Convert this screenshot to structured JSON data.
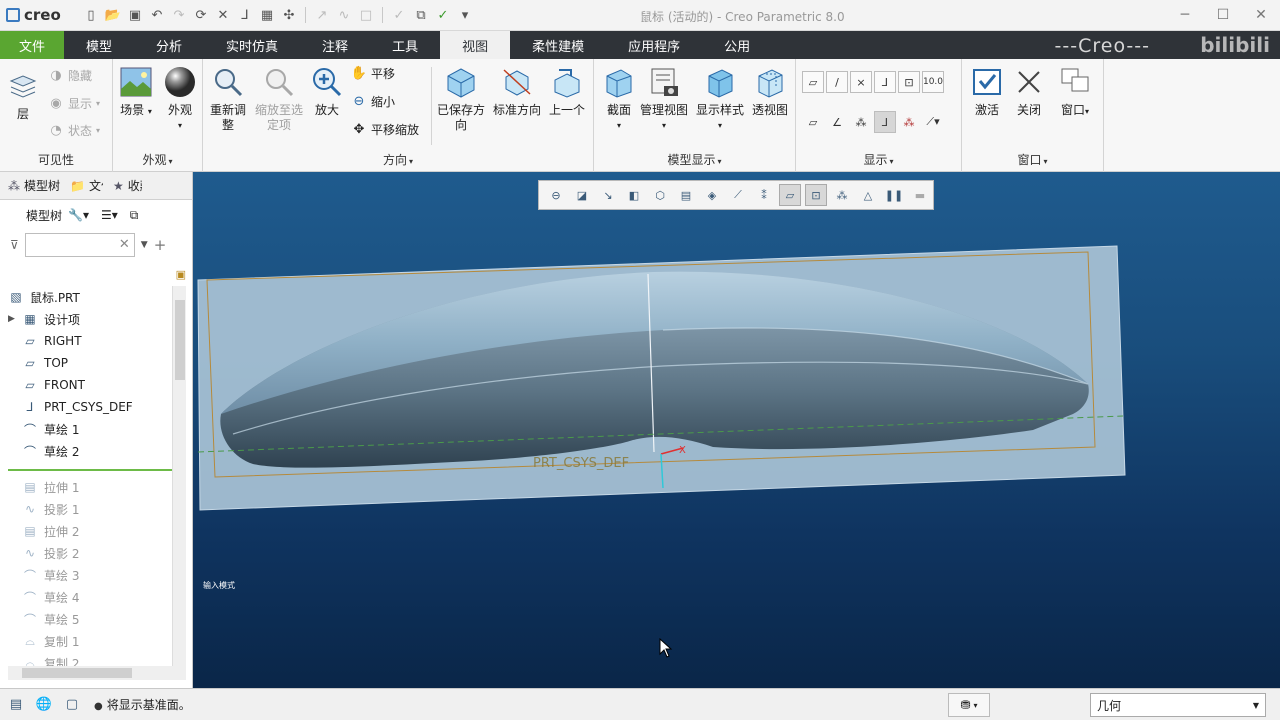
{
  "app": {
    "logo": "creo",
    "window_title": "鼠标 (活动的) - Creo Parametric 8.0"
  },
  "tabs": [
    "文件",
    "模型",
    "分析",
    "实时仿真",
    "注释",
    "工具",
    "视图",
    "柔性建模",
    "应用程序",
    "公用"
  ],
  "active_tab": "视图",
  "brand": "---Creo---",
  "watermark": "bilibili",
  "ribbon": {
    "visibility": {
      "label": "可见性",
      "layer": "层",
      "hide": "隐藏",
      "show": "显示",
      "status": "状态"
    },
    "appearance": {
      "label": "外观",
      "scene": "场景",
      "appearance": "外观"
    },
    "orientation": {
      "label": "方向",
      "refit": "重新调整",
      "zoom_to_selected": "缩放至选定项",
      "zoom_in": "放大",
      "pan": "平移",
      "zoom_out": "缩小",
      "pan_zoom": "平移缩放",
      "saved_orientations": "已保存方向",
      "standard_orientation": "标准方向",
      "previous": "上一个"
    },
    "model_display": {
      "label": "模型显示",
      "section": "截面",
      "manage_views": "管理视图",
      "display_style": "显示样式",
      "perspective": "透视图"
    },
    "show": {
      "label": "显示",
      "decimal": "10.0"
    },
    "window": {
      "label": "窗口",
      "activate": "激活",
      "close": "关闭",
      "windows": "窗口"
    }
  },
  "left_panel": {
    "tabs": [
      "模型树",
      "文件",
      "收藏"
    ],
    "tree_label": "模型树",
    "filter_placeholder": "",
    "items": [
      {
        "label": "鼠标.PRT",
        "icon": "part-icon",
        "expand": "",
        "gray": false
      },
      {
        "label": "设计项",
        "icon": "design-items-icon",
        "expand": "▶",
        "gray": false
      },
      {
        "label": "RIGHT",
        "icon": "datum-plane-icon",
        "expand": "",
        "gray": false
      },
      {
        "label": "TOP",
        "icon": "datum-plane-icon",
        "expand": "",
        "gray": false
      },
      {
        "label": "FRONT",
        "icon": "datum-plane-icon",
        "expand": "",
        "gray": false
      },
      {
        "label": "PRT_CSYS_DEF",
        "icon": "csys-icon",
        "expand": "",
        "gray": false
      },
      {
        "label": "草绘 1",
        "icon": "sketch-icon",
        "expand": "",
        "gray": false
      },
      {
        "label": "草绘 2",
        "icon": "sketch-icon",
        "expand": "",
        "gray": false
      }
    ],
    "suppressed": [
      {
        "label": "拉伸 1",
        "icon": "extrude-icon"
      },
      {
        "label": "投影 1",
        "icon": "projection-icon"
      },
      {
        "label": "拉伸 2",
        "icon": "extrude-icon"
      },
      {
        "label": "投影 2",
        "icon": "projection-icon"
      },
      {
        "label": "草绘 3",
        "icon": "sketch-icon"
      },
      {
        "label": "草绘 4",
        "icon": "sketch-icon"
      },
      {
        "label": "草绘 5",
        "icon": "sketch-icon"
      },
      {
        "label": "复制 1",
        "icon": "copy-icon"
      },
      {
        "label": "复制 2",
        "icon": "copy-icon"
      }
    ]
  },
  "viewport": {
    "csys_label": "PRT_CSYS_DEF",
    "input_mode": "输入模式"
  },
  "status": {
    "message": "将显示基准面。",
    "selection_filter": "几何"
  },
  "colors": {
    "file_tab": "#5aa631",
    "tab_bar": "#2f3338",
    "viewport_top": "#1f5b8e",
    "viewport_bottom": "#0a2648",
    "model_surface": "#9fb9cc"
  }
}
